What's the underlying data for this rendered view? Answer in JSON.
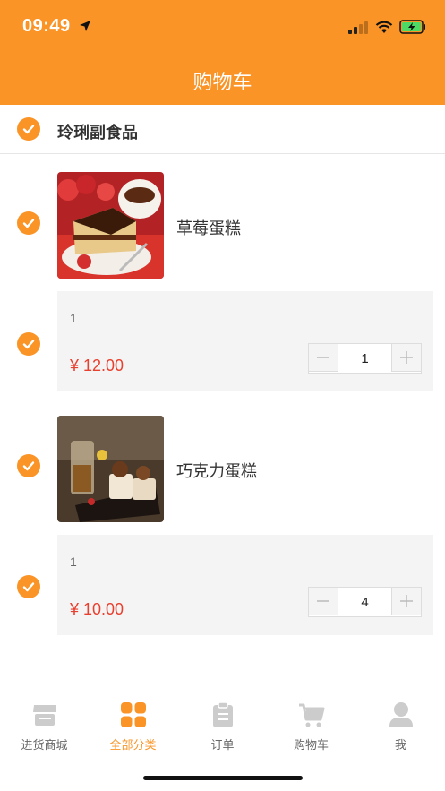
{
  "status_bar": {
    "time": "09:49"
  },
  "nav": {
    "title": "购物车"
  },
  "shop": {
    "name": "玲琍副食品"
  },
  "items": [
    {
      "name": "草莓蛋糕",
      "spec": "1",
      "price": "¥ 12.00",
      "quantity": "1"
    },
    {
      "name": "巧克力蛋糕",
      "spec": "1",
      "price": "¥ 10.00",
      "quantity": "4"
    }
  ],
  "tabs": [
    {
      "label": "进货商城",
      "icon": "store-icon",
      "active": false
    },
    {
      "label": "全部分类",
      "icon": "category-grid-icon",
      "active": true
    },
    {
      "label": "订单",
      "icon": "clipboard-icon",
      "active": false
    },
    {
      "label": "购物车",
      "icon": "cart-icon",
      "active": false
    },
    {
      "label": "我",
      "icon": "profile-icon",
      "active": false
    }
  ],
  "colors": {
    "accent": "#fa9426",
    "price": "#e8402f",
    "inactive": "#cccccc"
  }
}
